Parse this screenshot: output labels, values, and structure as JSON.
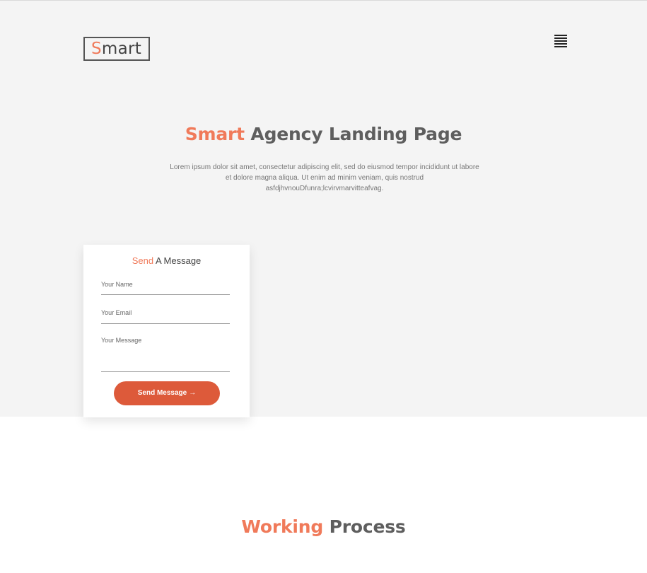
{
  "brand": {
    "logo_first_letter": "S",
    "logo_rest": "mart",
    "accent_color": "#f07a5a"
  },
  "header": {
    "menu_icon": "hamburger-menu-icon"
  },
  "hero": {
    "title_accent": "Smart",
    "title_rest": " Agency Landing Page",
    "description": "Lorem ipsum dolor sit amet, consectetur adipiscing elit, sed do eiusmod tempor incididunt ut labore et dolore magna aliqua. Ut enim ad minim veniam, quis nostrud asfdjhvnouDfunra;lcvirvmarvitteafvag."
  },
  "contact_form": {
    "title_accent": "Send",
    "title_rest": " A Message",
    "name_placeholder": "Your Name",
    "email_placeholder": "Your Email",
    "message_placeholder": "Your Message",
    "submit_label": "Send Message",
    "submit_arrow": "→",
    "button_color": "#dd5a3a"
  },
  "working_process": {
    "title_accent": "Working",
    "title_rest": " Process"
  }
}
